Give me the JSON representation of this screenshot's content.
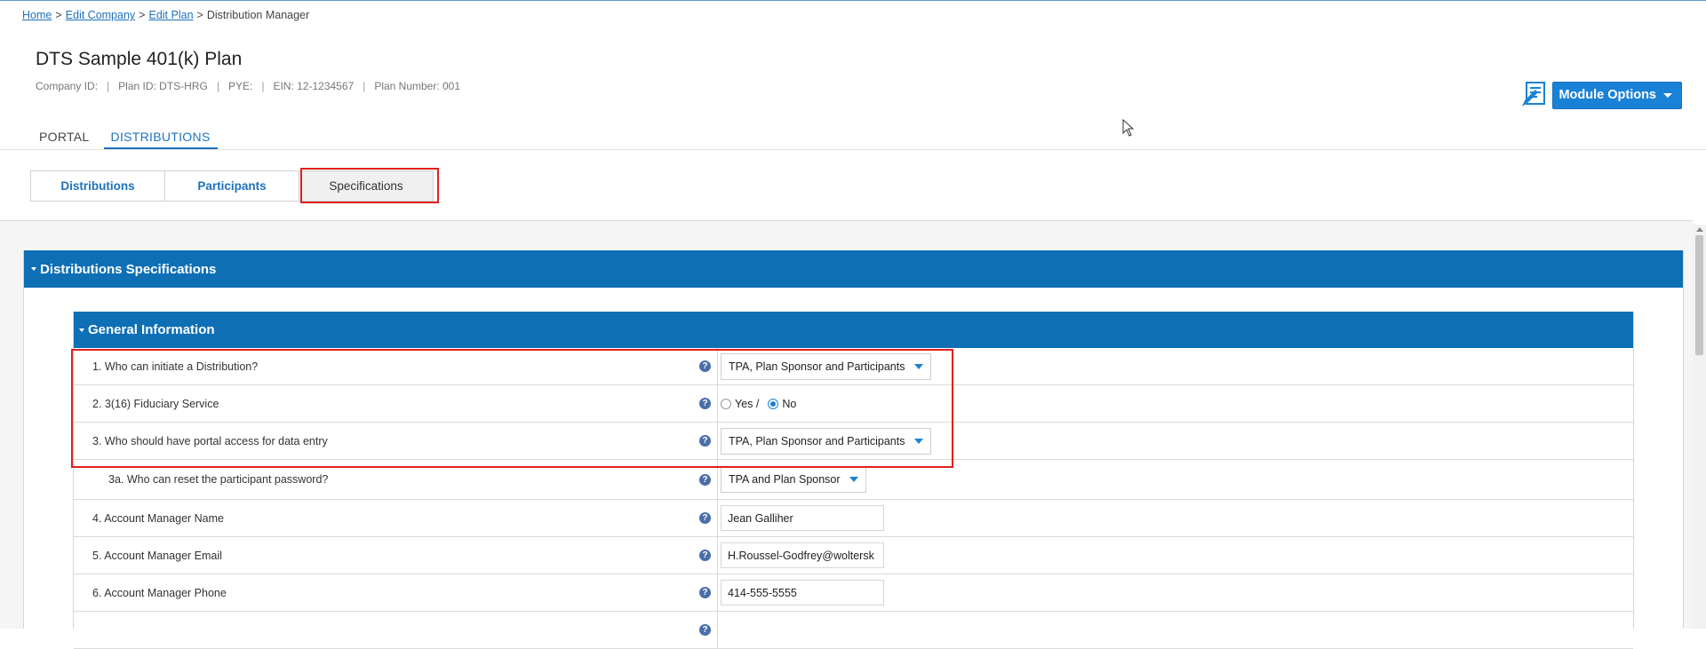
{
  "breadcrumb": {
    "items": [
      {
        "label": "Home",
        "link": true
      },
      {
        "label": "Edit Company",
        "link": true
      },
      {
        "label": "Edit Plan",
        "link": true
      },
      {
        "label": "Distribution Manager",
        "link": false
      }
    ],
    "separator": ">"
  },
  "plan": {
    "title": "DTS Sample 401(k) Plan",
    "company_id": "Company ID:",
    "plan_id": "Plan ID: DTS-HRG",
    "pye": "PYE:",
    "ein": "EIN: 12-1234567",
    "plan_number": "Plan Number: 001",
    "divider": "|"
  },
  "module_options": {
    "label": "Module Options",
    "icon": "document-edit-icon"
  },
  "main_tabs": [
    {
      "label": "PORTAL",
      "active": false
    },
    {
      "label": "DISTRIBUTIONS",
      "active": true
    }
  ],
  "sub_tabs": [
    {
      "label": "Distributions",
      "active": false
    },
    {
      "label": "Participants",
      "active": false
    },
    {
      "label": "Specifications",
      "active": true
    }
  ],
  "panel": {
    "title": "Distributions Specifications"
  },
  "section": {
    "title": "General Information"
  },
  "rows": [
    {
      "label": "1. Who can initiate a Distribution?",
      "type": "select",
      "value": "TPA, Plan Sponsor and Participants"
    },
    {
      "label": "2. 3(16) Fiduciary Service",
      "type": "radio",
      "yes": "Yes /",
      "no": "No",
      "selected": "No"
    },
    {
      "label": "3. Who should have portal access for data entry",
      "type": "select",
      "value": "TPA, Plan Sponsor and Participants"
    },
    {
      "label": "3a. Who can reset the participant password?",
      "type": "select",
      "value": "TPA and Plan Sponsor"
    },
    {
      "label": "4. Account Manager Name",
      "type": "text",
      "value": "Jean Galliher"
    },
    {
      "label": "5. Account Manager Email",
      "type": "text",
      "value": "H.Roussel-Godfrey@woltersk"
    },
    {
      "label": "6. Account Manager Phone",
      "type": "text",
      "value": "414-555-5555"
    }
  ],
  "help_glyph": "?",
  "colors": {
    "accent": "#0f6fb5",
    "link": "#1e72bf",
    "highlight": "#e02020"
  }
}
